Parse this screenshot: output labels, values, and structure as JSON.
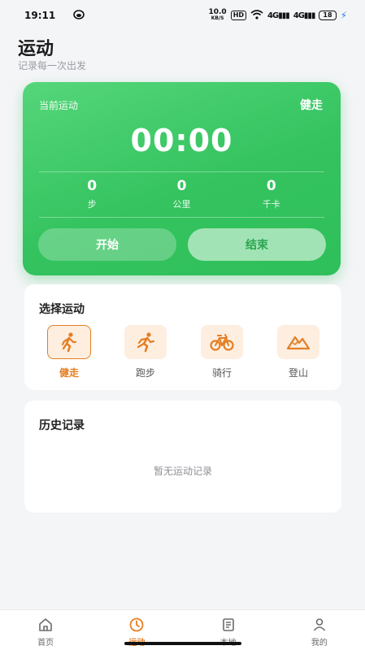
{
  "status_bar": {
    "time": "19:11",
    "net_speed": "10.0",
    "net_unit": "KB/S",
    "hd": "HD",
    "signal1": "4G",
    "signal2": "4G",
    "battery": "18"
  },
  "header": {
    "title": "运动",
    "subtitle": "记录每一次出发"
  },
  "run_card": {
    "label": "当前运动",
    "type": "健走",
    "timer": "00:00",
    "stats": [
      {
        "value": "0",
        "unit": "步"
      },
      {
        "value": "0",
        "unit": "公里"
      },
      {
        "value": "0",
        "unit": "千卡"
      }
    ],
    "start_label": "开始",
    "stop_label": "结束"
  },
  "sport_select": {
    "title": "选择运动",
    "items": [
      {
        "label": "健走",
        "icon": "walk-icon",
        "active": true
      },
      {
        "label": "跑步",
        "icon": "run-icon",
        "active": false
      },
      {
        "label": "骑行",
        "icon": "bike-icon",
        "active": false
      },
      {
        "label": "登山",
        "icon": "mountain-icon",
        "active": false
      }
    ]
  },
  "history": {
    "title": "历史记录",
    "empty_text": "暂无运动记录"
  },
  "bottom_nav": {
    "items": [
      {
        "label": "首页",
        "icon": "home-icon"
      },
      {
        "label": "运动",
        "icon": "clock-icon",
        "active": true
      },
      {
        "label": "本地",
        "icon": "document-icon"
      },
      {
        "label": "我的",
        "icon": "person-icon"
      }
    ]
  },
  "colors": {
    "green": "#34c35f",
    "accent_orange": "#e67e22",
    "icon_bg": "#fdeee0"
  }
}
